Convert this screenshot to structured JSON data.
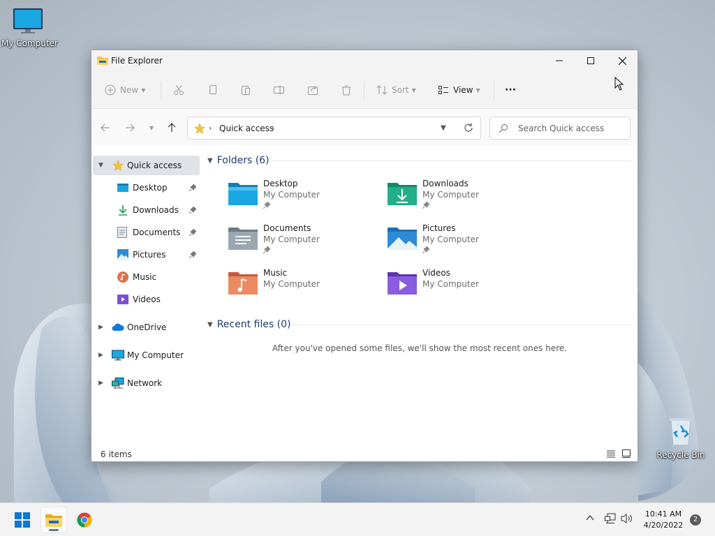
{
  "desktop": {
    "icons": [
      {
        "label": "My Computer",
        "icon": "monitor-icon"
      },
      {
        "label": "Recycle Bin",
        "icon": "recycle-bin-icon"
      }
    ]
  },
  "window": {
    "title": "File Explorer",
    "controls": {
      "minimize": "minimize-icon",
      "maximize": "maximize-icon",
      "close": "close-icon"
    }
  },
  "toolbar": {
    "new_label": "New",
    "sort_label": "Sort",
    "view_label": "View",
    "more_label": "···"
  },
  "address": {
    "location": "Quick access",
    "search_placeholder": "Search Quick access"
  },
  "sidebar": {
    "quick_access": "Quick access",
    "pinned": [
      {
        "label": "Desktop",
        "pinned": true
      },
      {
        "label": "Downloads",
        "pinned": true
      },
      {
        "label": "Documents",
        "pinned": true
      },
      {
        "label": "Pictures",
        "pinned": true
      },
      {
        "label": "Music",
        "pinned": false
      },
      {
        "label": "Videos",
        "pinned": false
      }
    ],
    "roots": [
      {
        "label": "OneDrive"
      },
      {
        "label": "My Computer"
      },
      {
        "label": "Network"
      }
    ]
  },
  "content": {
    "folders_header": "Folders (6)",
    "folders": [
      {
        "name": "Desktop",
        "location": "My Computer",
        "pinned": true
      },
      {
        "name": "Downloads",
        "location": "My Computer",
        "pinned": true
      },
      {
        "name": "Documents",
        "location": "My Computer",
        "pinned": true
      },
      {
        "name": "Pictures",
        "location": "My Computer",
        "pinned": true
      },
      {
        "name": "Music",
        "location": "My Computer",
        "pinned": false
      },
      {
        "name": "Videos",
        "location": "My Computer",
        "pinned": false
      }
    ],
    "recent_header": "Recent files (0)",
    "recent_empty": "After you've opened some files, we'll show the most recent ones here."
  },
  "status": {
    "item_count": "6 items"
  },
  "taskbar": {
    "time": "10:41 AM",
    "date": "4/20/2022",
    "notification_count": "2"
  },
  "colors": {
    "accent": "#0067c0",
    "folder_yellow": "#f4c542",
    "selected_bg": "#dfe3e8",
    "header_text": "#1f3c6b"
  }
}
